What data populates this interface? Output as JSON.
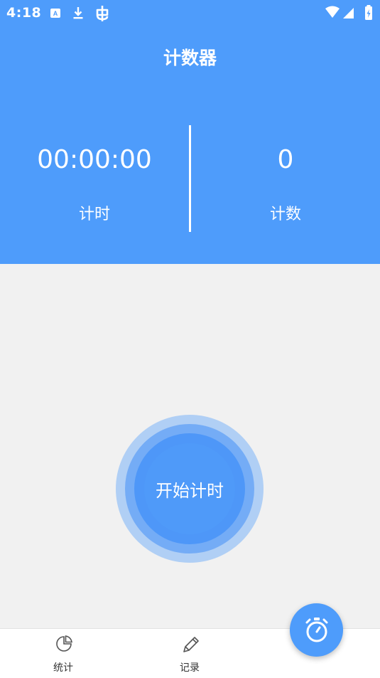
{
  "status_bar": {
    "time": "4:18",
    "left_icons": [
      "app-a-icon",
      "download-icon",
      "bug-icon"
    ],
    "right_icons": [
      "wifi-icon",
      "signal-icon",
      "battery-charging-icon"
    ]
  },
  "header": {
    "title": "计数器",
    "timer": {
      "value": "00:00:00",
      "label": "计时"
    },
    "counter": {
      "value": "0",
      "label": "计数"
    }
  },
  "main": {
    "start_button_label": "开始计时"
  },
  "bottom_nav": {
    "items": [
      {
        "label": "统计",
        "icon": "pie-chart-icon"
      },
      {
        "label": "记录",
        "icon": "pencil-icon"
      }
    ]
  },
  "fab": {
    "icon": "stopwatch-icon"
  },
  "colors": {
    "primary": "#4e9cfb",
    "background": "#f1f1f1",
    "nav_background": "#ffffff"
  }
}
